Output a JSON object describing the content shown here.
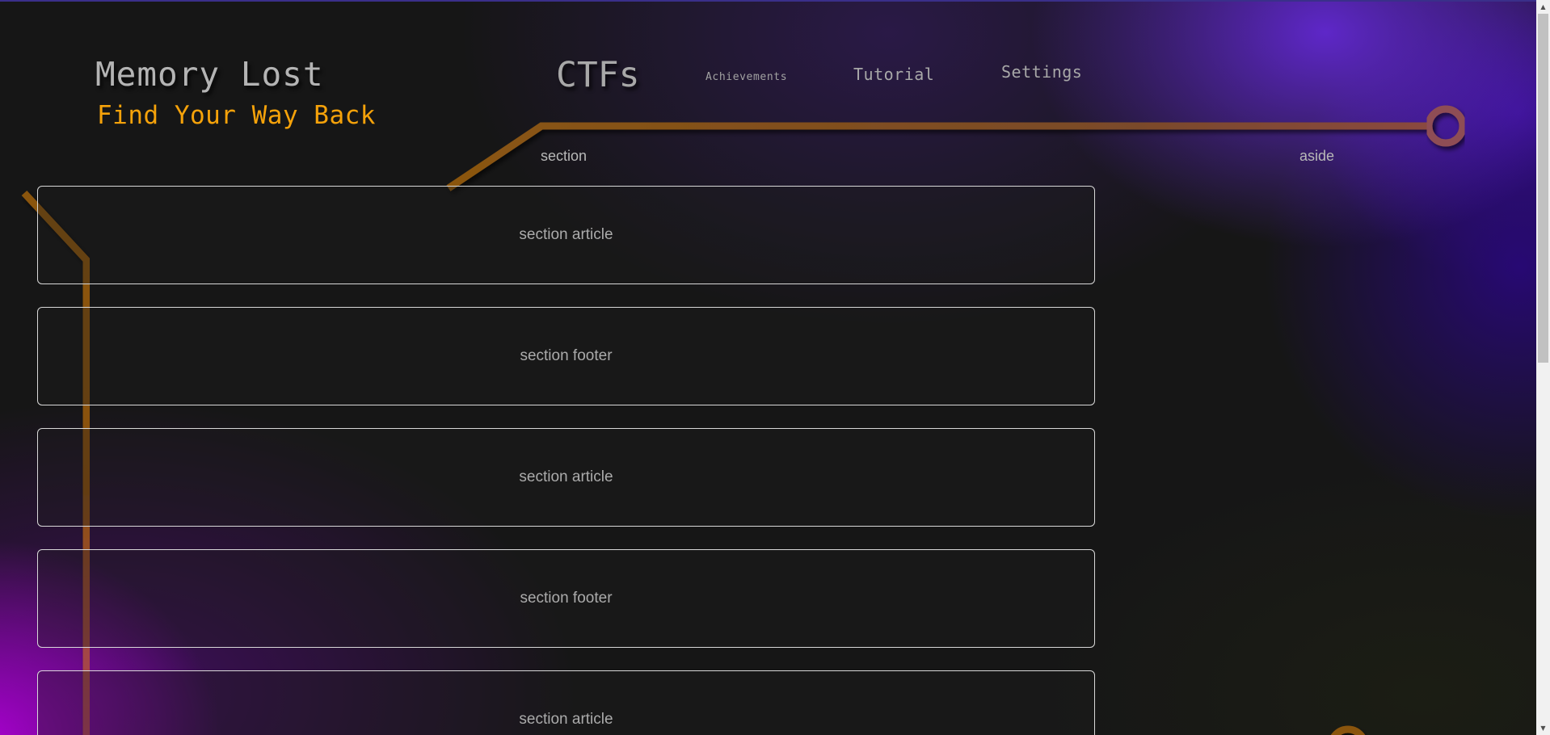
{
  "header": {
    "title": "Memory Lost",
    "subtitle": "Find Your Way Back"
  },
  "nav": {
    "ctfs": "CTFs",
    "achievements": "Achievements",
    "tutorial": "Tutorial",
    "settings": "Settings"
  },
  "layout_labels": {
    "section": "section",
    "aside": "aside"
  },
  "cards": [
    {
      "label": "section article"
    },
    {
      "label": "section footer"
    },
    {
      "label": "section article"
    },
    {
      "label": "section footer"
    },
    {
      "label": "section article"
    }
  ],
  "colors": {
    "accent_orange": "#f5a20a",
    "circuit_trace": "#8a5510",
    "background": "#161616",
    "glow_purple": "#6228d2",
    "glow_magenta": "#af00d7"
  },
  "icons": {
    "scroll_up": "▲",
    "scroll_down": "▼"
  }
}
